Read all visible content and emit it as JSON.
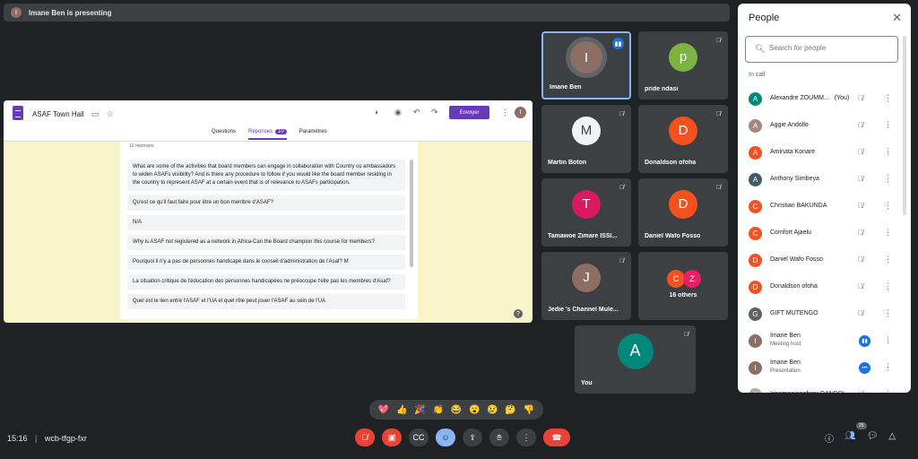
{
  "presenting_bar": {
    "initial": "I",
    "text": "Imane Ben is presenting"
  },
  "form": {
    "title": "ASAF Town Hall",
    "send_label": "Envoyer",
    "user_initial": "I",
    "tabs": [
      {
        "label": "Questions"
      },
      {
        "label": "Réponses",
        "badge": "10"
      },
      {
        "label": "Paramètres"
      }
    ],
    "response_count": "10 réponses",
    "responses": [
      "What are some of the activities that board members can engage in collaboration with Country co ambassadors to widen ASAFs visibility? And is there any procedure to follow if you would like the board member residing in the country to represent ASAF at a certain event that is of relevance to ASAFs participation.",
      "Qu'est ce qu'il faut faire pour être un bon membre d'ASAF?",
      "N/A",
      "Why is ASAF not registered as a network in Africa-Can the Board champion this course for members?",
      "Pourquoi il n'y a pas de personnes handicapé dans le conseil d'administration de l'Asaf? M",
      "La situation critique de l'éducation des personnes handicapées ne préoccupe t'elle pas les membres d'Asaf?",
      "Quel est le lien entre l'ASAF et l'UA et quel rôle peut jouer l'ASAF au sein de l'UA"
    ],
    "help_glyph": "?"
  },
  "tiles": [
    {
      "name": "Imane Ben",
      "initial": "I",
      "color": "#8d6e63",
      "speaking": true
    },
    {
      "name": "pride ndasi",
      "initial": "p",
      "color": "#7cb342"
    },
    {
      "name": "Martin Boton",
      "initial": "M",
      "color": "#f1f3f4"
    },
    {
      "name": "Donaldson ofoha",
      "initial": "D",
      "color": "#f4511e"
    },
    {
      "name": "Tamawoe Zimare ISSI...",
      "initial": "T",
      "color": "#d81b60"
    },
    {
      "name": "Daniel Wafo Fosso",
      "initial": "D",
      "color": "#f4511e"
    },
    {
      "name": "Jedie 's Channel Mule...",
      "initial": "J",
      "color": "#8d6e63"
    },
    {
      "name": "16 others",
      "initial_a": "C",
      "initial_b": "Z",
      "color_a": "#f4511e",
      "color_b": "#e91e63"
    },
    {
      "name": "You",
      "initial": "A",
      "color": "#00897b"
    }
  ],
  "people_panel": {
    "title": "People",
    "search_placeholder": "Search for people",
    "section": "In call",
    "people": [
      {
        "name": "Alexandre ZOUMM...",
        "tag": "(You)",
        "initial": "A",
        "color": "#00897b"
      },
      {
        "name": "Aggie Andollo",
        "initial": "A",
        "color": "#a1887f"
      },
      {
        "name": "Aminata Konare",
        "initial": "A",
        "color": "#f4511e"
      },
      {
        "name": "Anthony Simbeya",
        "initial": "A",
        "color": "#455a64"
      },
      {
        "name": "Christian BAKUNDA",
        "initial": "C",
        "color": "#f4511e"
      },
      {
        "name": "Comfort Ajaelu",
        "initial": "C",
        "color": "#f4511e"
      },
      {
        "name": "Daniel Wafo Fosso",
        "initial": "D",
        "color": "#f4511e"
      },
      {
        "name": "Donaldson ofoha",
        "initial": "D",
        "color": "#f4511e"
      },
      {
        "name": "GIFT MUTENGO",
        "initial": "G",
        "color": "#616161"
      },
      {
        "name": "Imane Ben",
        "subtitle": "Meeting host",
        "initial": "I",
        "color": "#8d6e63",
        "status": "speaking"
      },
      {
        "name": "Imane Ben",
        "subtitle": "Presentation",
        "initial": "I",
        "color": "#8d6e63",
        "status": "more"
      },
      {
        "name": "Irinomenjanahary RANDRI...",
        "initial": "I",
        "color": "#bcaaa4"
      }
    ]
  },
  "reactions": [
    "💖",
    "👍",
    "🎉",
    "👏",
    "😂",
    "😮",
    "😢",
    "🤔",
    "👎"
  ],
  "meeting": {
    "time": "15:16",
    "code": "wcb-tfgp-fxr",
    "participant_count": "25"
  }
}
